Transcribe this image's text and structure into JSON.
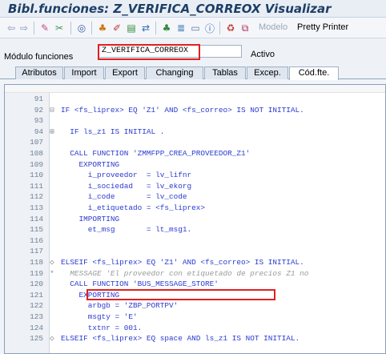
{
  "window": {
    "title": "Bibl.funciones: Z_VERIFICA_CORREOX Visualizar"
  },
  "toolbar": {
    "icons": [
      "back-arrow-icon",
      "forward-arrow-icon",
      "other-object-icon",
      "toggle-display-change-icon",
      "activate-icon",
      "where-used-icon",
      "edit-pencil-icon",
      "object-list-icon",
      "display-navigation-icon",
      "hierarchy-icon",
      "align-icon",
      "window-icon",
      "info-icon",
      "test-icon",
      "debug-icon"
    ],
    "modelo_label": "Modelo",
    "pretty_printer_label": "Pretty Printer"
  },
  "module": {
    "label": "Módulo funciones",
    "value": "Z_VERIFICA_CORREOX",
    "status": "Activo"
  },
  "tabs": [
    {
      "label": "Atributos"
    },
    {
      "label": "Import"
    },
    {
      "label": "Export"
    },
    {
      "label": "Changing"
    },
    {
      "label": "Tablas"
    },
    {
      "label": "Excep."
    },
    {
      "label": "Cód.fte."
    }
  ],
  "code": [
    {
      "num": "91",
      "marker": "",
      "text": ""
    },
    {
      "num": "92",
      "marker": "⊟",
      "text": "IF <fs_liprex> EQ 'Z1' AND <fs_correo> IS NOT INITIAL."
    },
    {
      "num": "93",
      "marker": "",
      "text": ""
    },
    {
      "num": "94",
      "marker": "⊞",
      "text": "  IF ls_z1 IS INITIAL ."
    },
    {
      "num": "107",
      "marker": "",
      "text": ""
    },
    {
      "num": "108",
      "marker": "",
      "text": "  CALL FUNCTION 'ZMMFPP_CREA_PROVEEDOR_Z1'"
    },
    {
      "num": "109",
      "marker": "",
      "text": "    EXPORTING"
    },
    {
      "num": "110",
      "marker": "",
      "text": "      i_proveedor  = lv_lifnr"
    },
    {
      "num": "111",
      "marker": "",
      "text": "      i_sociedad   = lv_ekorg"
    },
    {
      "num": "112",
      "marker": "",
      "text": "      i_code       = lv_code"
    },
    {
      "num": "113",
      "marker": "",
      "text": "      i_etiquetado = <fs_liprex>"
    },
    {
      "num": "114",
      "marker": "",
      "text": "    IMPORTING"
    },
    {
      "num": "115",
      "marker": "",
      "text": "      et_msg       = lt_msg1."
    },
    {
      "num": "116",
      "marker": "",
      "text": ""
    },
    {
      "num": "117",
      "marker": "",
      "text": ""
    },
    {
      "num": "118",
      "marker": "◇",
      "text": "ELSEIF <fs_liprex> EQ 'Z1' AND <fs_correo> IS INITIAL."
    },
    {
      "num": "119",
      "marker": "*",
      "text": "  MESSAGE 'El proveedor con etiquetado de precios Z1 no",
      "comment": true
    },
    {
      "num": "120",
      "marker": "",
      "text": "  CALL FUNCTION 'BUS_MESSAGE_STORE'"
    },
    {
      "num": "121",
      "marker": "",
      "text": "    EXPORTING"
    },
    {
      "num": "122",
      "marker": "",
      "text": "      arbgb = 'ZBP_PORTPV'"
    },
    {
      "num": "123",
      "marker": "",
      "text": "      msgty = 'E'"
    },
    {
      "num": "124",
      "marker": "",
      "text": "      txtnr = 001."
    },
    {
      "num": "125",
      "marker": "◇",
      "text": "ELSEIF <fs_liprex> EQ space AND ls_z1 IS NOT INITIAL."
    }
  ]
}
